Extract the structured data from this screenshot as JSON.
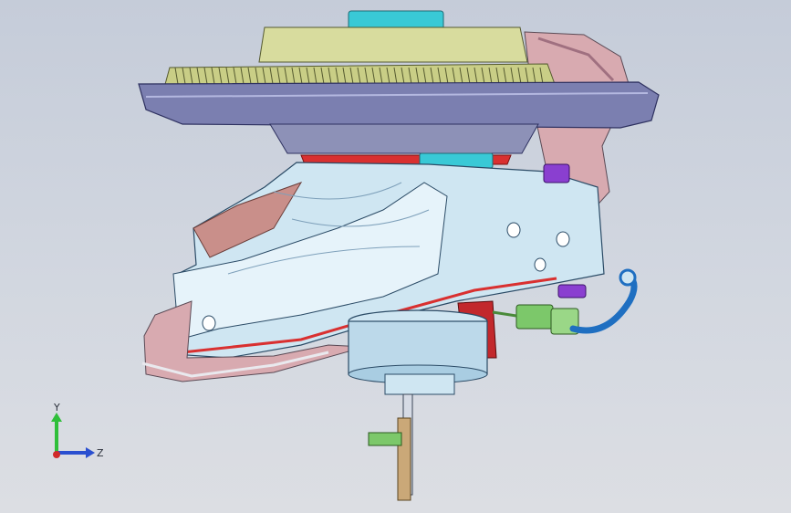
{
  "viewport": {
    "background_top": "#c5ccd9",
    "background_bottom": "#dcdee3",
    "model_colors": {
      "gear": "#d8dc9e",
      "plate": "#7b7fb0",
      "cap": "#39c9d6",
      "body": "#cfe6f2",
      "accent_red": "#d93030",
      "bracket_pink": "#d8aab0",
      "connector_green": "#7cc86a",
      "hose_blue": "#1f6fc1",
      "purple": "#8a3fd0"
    }
  },
  "triad": {
    "y_label": "Y",
    "z_label": "Z",
    "y_color": "#2fbf3a",
    "z_color": "#2a4fd0",
    "x_color": "#d02a2a"
  }
}
